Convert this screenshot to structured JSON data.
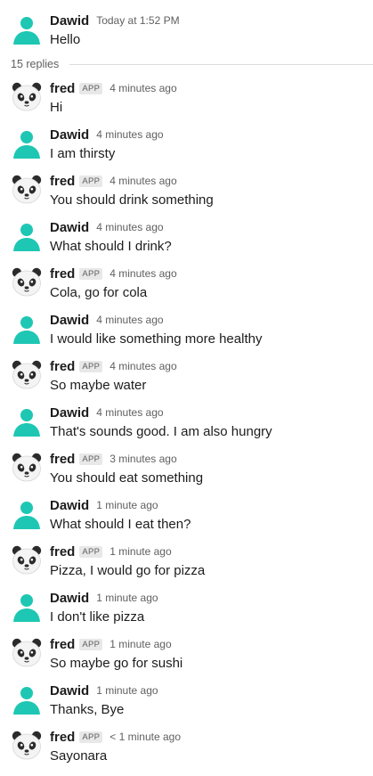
{
  "root": {
    "author": "Dawid",
    "timestamp": "Today at 1:52 PM",
    "text": "Hello"
  },
  "replies_label": "15 replies",
  "app_badge": "APP",
  "colors": {
    "user_avatar": "#1ec7b3",
    "panda_black": "#2b2b2b",
    "text": "#1d1c1d",
    "muted": "#616061"
  },
  "replies": [
    {
      "author": "fred",
      "bot": true,
      "time": "4 minutes ago",
      "text": "Hi"
    },
    {
      "author": "Dawid",
      "bot": false,
      "time": "4 minutes ago",
      "text": "I am thirsty"
    },
    {
      "author": "fred",
      "bot": true,
      "time": "4 minutes ago",
      "text": "You should drink something"
    },
    {
      "author": "Dawid",
      "bot": false,
      "time": "4 minutes ago",
      "text": "What should I drink?"
    },
    {
      "author": "fred",
      "bot": true,
      "time": "4 minutes ago",
      "text": "Cola, go for cola"
    },
    {
      "author": "Dawid",
      "bot": false,
      "time": "4 minutes ago",
      "text": "I would like something more healthy"
    },
    {
      "author": "fred",
      "bot": true,
      "time": "4 minutes ago",
      "text": "So maybe water"
    },
    {
      "author": "Dawid",
      "bot": false,
      "time": "4 minutes ago",
      "text": "That's sounds good. I am also hungry"
    },
    {
      "author": "fred",
      "bot": true,
      "time": "3 minutes ago",
      "text": "You should eat something"
    },
    {
      "author": "Dawid",
      "bot": false,
      "time": "1 minute ago",
      "text": "What should I eat then?"
    },
    {
      "author": "fred",
      "bot": true,
      "time": "1 minute ago",
      "text": "Pizza, I would go for pizza"
    },
    {
      "author": "Dawid",
      "bot": false,
      "time": "1 minute ago",
      "text": "I don't like pizza"
    },
    {
      "author": "fred",
      "bot": true,
      "time": "1 minute ago",
      "text": "So maybe go for sushi"
    },
    {
      "author": "Dawid",
      "bot": false,
      "time": "1 minute ago",
      "text": "Thanks, Bye"
    },
    {
      "author": "fred",
      "bot": true,
      "time": "< 1 minute ago",
      "text": "Sayonara"
    }
  ]
}
